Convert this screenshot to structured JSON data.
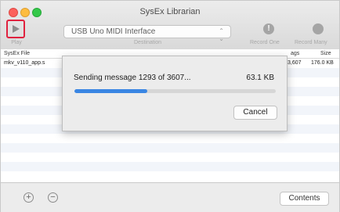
{
  "window": {
    "title": "SysEx Librarian"
  },
  "toolbar": {
    "play_label": "Play",
    "destination_value": "USB Uno MIDI Interface",
    "destination_label": "Destination",
    "record_one_label": "Record One",
    "record_many_label": "Record Many"
  },
  "table": {
    "headers": {
      "file": "SysEx File",
      "messages": "ags",
      "size": "Size"
    },
    "rows": [
      {
        "file": "mkv_v110_app.s",
        "messages": "3,607",
        "size": "176.0 KB"
      }
    ]
  },
  "sheet": {
    "message": "Sending message 1293 of 3607...",
    "size": "63.1 KB",
    "progress": 0.36,
    "cancel_label": "Cancel"
  },
  "footer": {
    "add_label": "+",
    "remove_label": "−",
    "contents_label": "Contents"
  },
  "colors": {
    "accent": "#3a86e3",
    "highlight": "#e0223f"
  }
}
